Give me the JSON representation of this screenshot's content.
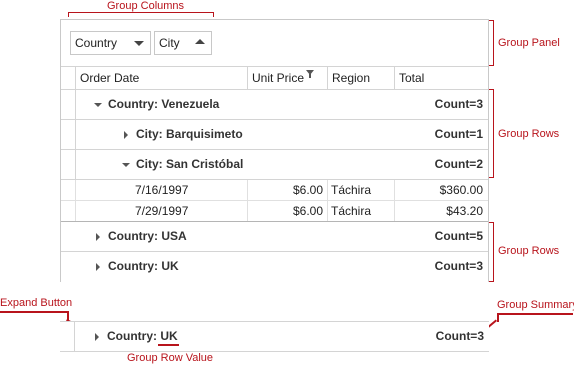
{
  "annotations": {
    "group_columns": "Group Columns",
    "group_panel": "Group Panel",
    "group_rows_1": "Group Rows",
    "group_rows_2": "Group Rows",
    "expand_button": "Expand Button",
    "group_summary": "Group Summary",
    "group_row_value": "Group Row Value"
  },
  "group_panel": {
    "chips": [
      {
        "label": "Country",
        "sort": "descending"
      },
      {
        "label": "City",
        "sort": "ascending"
      }
    ]
  },
  "columns": [
    "Order Date",
    "Unit Price",
    "Region",
    "Total"
  ],
  "rows": {
    "venezuela": {
      "label": "Country: Venezuela",
      "count": "Count=3",
      "expanded": true
    },
    "barquisimeto": {
      "label": "City: Barquisimeto",
      "count": "Count=1",
      "expanded": false
    },
    "san_cristobal": {
      "label": "City: San Cristóbal",
      "count": "Count=2",
      "expanded": true
    },
    "data": [
      {
        "date": "7/16/1997",
        "price": "$6.00",
        "region": "Táchira",
        "total": "$360.00"
      },
      {
        "date": "7/29/1997",
        "price": "$6.00",
        "region": "Táchira",
        "total": "$43.20"
      }
    ],
    "usa": {
      "label": "Country: USA",
      "count": "Count=5",
      "expanded": false
    },
    "uk": {
      "label": "Country: UK",
      "count": "Count=3",
      "expanded": false
    }
  },
  "example_row": {
    "prefix": "Country: ",
    "value": "UK",
    "count": "Count=3"
  },
  "colors": {
    "annotation": "#b8141c",
    "grid_border": "#c9c9c9"
  }
}
